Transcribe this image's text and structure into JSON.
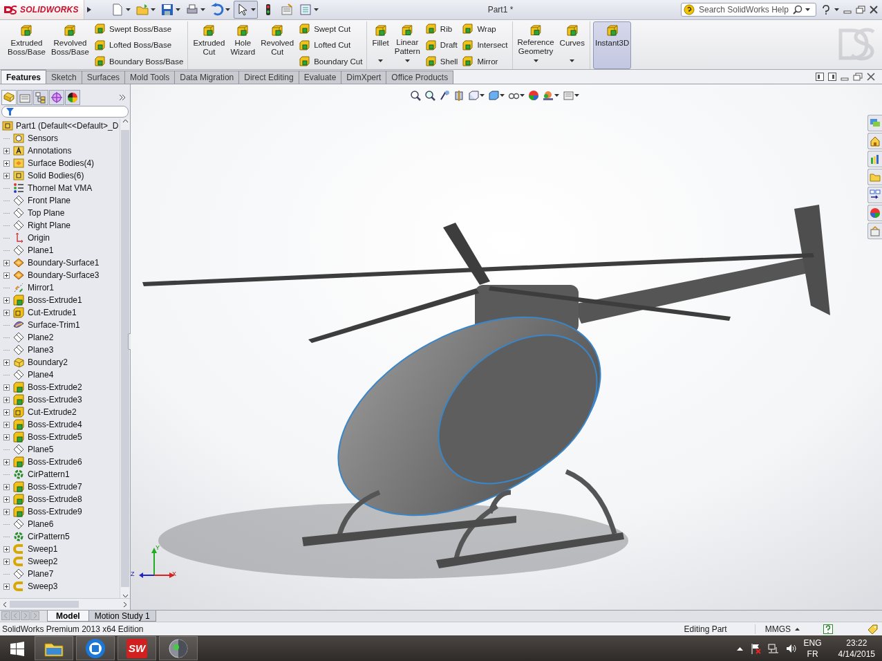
{
  "titlebar": {
    "logo": "SOLIDWORKS",
    "title": "Part1 *",
    "search_placeholder": "Search SolidWorks Help"
  },
  "ribbon": {
    "groups": [
      {
        "columns": [
          {
            "kind": "large",
            "label": "Extruded\nBoss/Base",
            "dropdown": false,
            "on": false
          },
          {
            "kind": "large",
            "label": "Revolved\nBoss/Base",
            "dropdown": false,
            "on": false
          },
          {
            "kind": "stack",
            "items": [
              "Swept Boss/Base",
              "Lofted Boss/Base",
              "Boundary Boss/Base"
            ]
          }
        ]
      },
      {
        "columns": [
          {
            "kind": "large",
            "label": "Extruded\nCut",
            "dropdown": false,
            "on": false
          },
          {
            "kind": "large",
            "label": "Hole\nWizard",
            "dropdown": false,
            "on": false
          },
          {
            "kind": "large",
            "label": "Revolved\nCut",
            "dropdown": false,
            "on": false
          },
          {
            "kind": "stack",
            "items": [
              "Swept Cut",
              "Lofted Cut",
              "Boundary Cut"
            ]
          }
        ]
      },
      {
        "columns": [
          {
            "kind": "large",
            "label": "Fillet",
            "dropdown": true,
            "on": false
          },
          {
            "kind": "large",
            "label": "Linear\nPattern",
            "dropdown": true,
            "on": false
          },
          {
            "kind": "stack",
            "items": [
              "Rib",
              "Draft",
              "Shell"
            ]
          },
          {
            "kind": "stack",
            "items": [
              "Wrap",
              "Intersect",
              "Mirror"
            ]
          }
        ]
      },
      {
        "columns": [
          {
            "kind": "large",
            "label": "Reference\nGeometry",
            "dropdown": true,
            "on": false
          },
          {
            "kind": "large",
            "label": "Curves",
            "dropdown": true,
            "on": false
          }
        ]
      },
      {
        "columns": [
          {
            "kind": "large",
            "label": "Instant3D",
            "dropdown": false,
            "on": true
          }
        ]
      }
    ]
  },
  "tabs": [
    {
      "label": "Features",
      "selected": true
    },
    {
      "label": "Sketch",
      "selected": false
    },
    {
      "label": "Surfaces",
      "selected": false
    },
    {
      "label": "Mold Tools",
      "selected": false
    },
    {
      "label": "Data Migration",
      "selected": false
    },
    {
      "label": "Direct Editing",
      "selected": false
    },
    {
      "label": "Evaluate",
      "selected": false
    },
    {
      "label": "DimXpert",
      "selected": false
    },
    {
      "label": "Office Products",
      "selected": false
    }
  ],
  "tree": {
    "root": {
      "label": "Part1  (Default<<Default>_D",
      "children": [
        {
          "label": "Sensors",
          "kind": "sensor",
          "expandable": false
        },
        {
          "label": "Annotations",
          "kind": "annotation",
          "expandable": true
        },
        {
          "label": "Surface Bodies(4)",
          "kind": "surfacefolder",
          "expandable": true
        },
        {
          "label": "Solid Bodies(6)",
          "kind": "solidfolder",
          "expandable": true
        },
        {
          "label": "Thornel Mat VMA",
          "kind": "material",
          "expandable": false
        },
        {
          "label": "Front Plane",
          "kind": "plane",
          "expandable": false
        },
        {
          "label": "Top Plane",
          "kind": "plane",
          "expandable": false
        },
        {
          "label": "Right Plane",
          "kind": "plane",
          "expandable": false
        },
        {
          "label": "Origin",
          "kind": "origin",
          "expandable": false
        },
        {
          "label": "Plane1",
          "kind": "plane",
          "expandable": false
        },
        {
          "label": "Boundary-Surface1",
          "kind": "surface",
          "expandable": true
        },
        {
          "label": "Boundary-Surface3",
          "kind": "surface",
          "expandable": true
        },
        {
          "label": "Mirror1",
          "kind": "mirror",
          "expandable": false
        },
        {
          "label": "Boss-Extrude1",
          "kind": "boss",
          "expandable": true
        },
        {
          "label": "Cut-Extrude1",
          "kind": "cut",
          "expandable": true
        },
        {
          "label": "Surface-Trim1",
          "kind": "trim",
          "expandable": false
        },
        {
          "label": "Plane2",
          "kind": "plane",
          "expandable": false
        },
        {
          "label": "Plane3",
          "kind": "plane",
          "expandable": false
        },
        {
          "label": "Boundary2",
          "kind": "boundary",
          "expandable": true
        },
        {
          "label": "Plane4",
          "kind": "plane",
          "expandable": false
        },
        {
          "label": "Boss-Extrude2",
          "kind": "boss",
          "expandable": true
        },
        {
          "label": "Boss-Extrude3",
          "kind": "boss",
          "expandable": true
        },
        {
          "label": "Cut-Extrude2",
          "kind": "cut",
          "expandable": true
        },
        {
          "label": "Boss-Extrude4",
          "kind": "boss",
          "expandable": true
        },
        {
          "label": "Boss-Extrude5",
          "kind": "boss",
          "expandable": true
        },
        {
          "label": "Plane5",
          "kind": "plane",
          "expandable": false
        },
        {
          "label": "Boss-Extrude6",
          "kind": "boss",
          "expandable": true
        },
        {
          "label": "CirPattern1",
          "kind": "pattern",
          "expandable": false
        },
        {
          "label": "Boss-Extrude7",
          "kind": "boss",
          "expandable": true
        },
        {
          "label": "Boss-Extrude8",
          "kind": "boss",
          "expandable": true
        },
        {
          "label": "Boss-Extrude9",
          "kind": "boss",
          "expandable": true
        },
        {
          "label": "Plane6",
          "kind": "plane",
          "expandable": false
        },
        {
          "label": "CirPattern5",
          "kind": "pattern",
          "expandable": false
        },
        {
          "label": "Sweep1",
          "kind": "sweep",
          "expandable": true
        },
        {
          "label": "Sweep2",
          "kind": "sweep",
          "expandable": true
        },
        {
          "label": "Plane7",
          "kind": "plane",
          "expandable": false
        },
        {
          "label": "Sweep3",
          "kind": "sweep",
          "expandable": true
        }
      ]
    }
  },
  "panel_tabs": [
    {
      "selected": true
    },
    {
      "selected": false
    },
    {
      "selected": false
    },
    {
      "selected": false
    },
    {
      "selected": false
    }
  ],
  "viewport": {
    "triad": {
      "x": "X",
      "y": "Y",
      "z": "Z"
    }
  },
  "bottom_tabs": [
    {
      "label": "Model",
      "selected": true
    },
    {
      "label": "Motion Study 1",
      "selected": false
    }
  ],
  "statusbar": {
    "edition": "SolidWorks Premium 2013 x64 Edition",
    "mode": "Editing Part",
    "units": "MMGS"
  },
  "taskbar": {
    "sw_label": "SW",
    "language": "ENG",
    "layout": "FR",
    "time": "23:22",
    "date": "4/14/2015"
  }
}
